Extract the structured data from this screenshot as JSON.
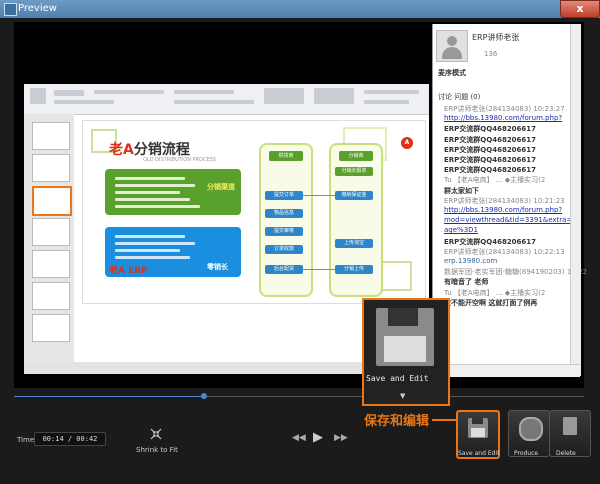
{
  "window": {
    "title": "Preview",
    "close_glyph": "x"
  },
  "slide": {
    "title_a": "老A",
    "title_rest": "分销流程",
    "subtitle": "OLD DISTRIBUTION PROCESS",
    "green_label": "分销渠道",
    "blue_label": "零销长",
    "logo": "老A ERP",
    "badge": "A",
    "col1_head": "供货商",
    "col2_head": "分销商",
    "nodes": [
      "分销长报单",
      "提交订单",
      "缴纳保证金",
      "物品信息",
      "提交审核",
      "订单收款",
      "后台配货",
      "上传淘宝",
      "分销上传"
    ]
  },
  "panel": {
    "user_name": "ERP讲师老张",
    "count": "136",
    "mode_label": "麦序模式",
    "tabs": "讨论   问题 (0)",
    "lines": [
      {
        "text": "ERP讲师老张(284134083) 10:23:27",
        "style": "grey"
      },
      {
        "text": "http://bbs.13980.com/forum.php?",
        "style": "link"
      },
      {
        "text": "ERP交流群QQ468206617",
        "style": "b"
      },
      {
        "text": "ERP交流群QQ468206617",
        "style": "b"
      },
      {
        "text": "ERP交流群QQ468206617",
        "style": "b"
      },
      {
        "text": "ERP交流群QQ468206617",
        "style": "b"
      },
      {
        "text": "ERP交流群QQ468206617",
        "style": "b"
      },
      {
        "text": "Tu 【老A电商】 ... ◆主播实习(2",
        "style": "grey"
      },
      {
        "text": "群太家如下",
        "style": "b"
      },
      {
        "text": "ERP讲师老张(284134083) 10:21:23",
        "style": "grey"
      },
      {
        "text": "http://bbs.13980.com/forum.php?",
        "style": "link"
      },
      {
        "text": "mod=viewthread&tid=3391&extra=p",
        "style": "link"
      },
      {
        "text": "age%3D1",
        "style": "link"
      },
      {
        "text": "ERP交流群QQ468206617",
        "style": "b"
      },
      {
        "text": "ERP讲师老张(284134083) 10:22:13",
        "style": "grey"
      },
      {
        "text": "erp.13980.com",
        "style": "blue"
      },
      {
        "text": "数据军团-老实军团-糖糖(894190203) 10:22",
        "style": "grey"
      },
      {
        "text": "有暗音了 老师",
        "style": "b"
      },
      {
        "text": "Tu 【老A电商】 ... ◆主播实习(2",
        "style": "grey"
      },
      {
        "text": "散不能开空啊  这就打面了例再",
        "style": "b"
      }
    ]
  },
  "player": {
    "time_label": "Time",
    "time_value": "00:14 / 00:42",
    "shrink_label": "Shrink to Fit",
    "progress_fraction": 0.333,
    "prev_glyph": "◀◀",
    "play_glyph": "▶",
    "next_glyph": "▶▶"
  },
  "actions": {
    "save_label": "Save and Edit",
    "produce_label": "Produce",
    "delete_label": "Delete",
    "callout_label": "Save and Edit",
    "callout_arrow": "▼",
    "cn_label": "保存和编辑"
  },
  "colors": {
    "accent": "#e8761a",
    "link": "#1a2fb0",
    "green": "#5aa02c",
    "blue": "#1a8fe0"
  }
}
